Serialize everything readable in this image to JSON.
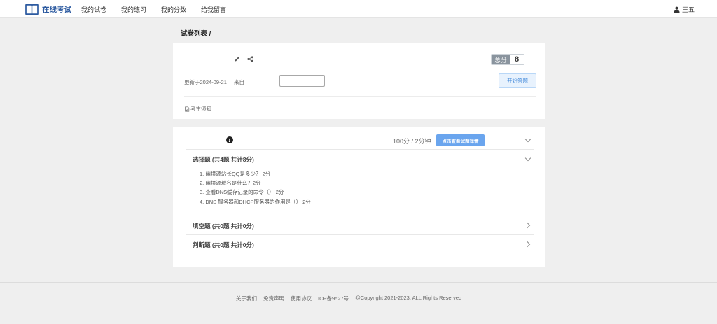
{
  "header": {
    "logo_text": "在线考试",
    "nav": [
      "我的试卷",
      "我的练习",
      "我的分数",
      "给我留言"
    ],
    "user_name": "王五"
  },
  "breadcrumb": "试卷列表 /",
  "exam_info": {
    "total_score_label": "总分",
    "total_score_value": "8",
    "updated": "更新于2024-09-21",
    "from_label": "来自",
    "start_button": "开始答题",
    "notice": "考生须知"
  },
  "summary": {
    "duration": "100分 / 2分钟",
    "detail_button": "点击查看试题详情"
  },
  "sections": [
    {
      "title": "选择题 (共4题 共计8分)",
      "expanded": true,
      "questions": [
        "1. 幽境源站长QQ是多少？ 2分",
        "2. 幽境源域名是什么？2分",
        "3. 查看DNS缓存记录的命令（） 2分",
        "4. DNS 服务器和DHCP服务器的作用是（） 2分"
      ]
    },
    {
      "title": "填空题 (共0题 共计0分)",
      "expanded": false
    },
    {
      "title": "判断题 (共0题 共计0分)",
      "expanded": false
    }
  ],
  "footer": {
    "links": [
      "关于我们",
      "免责声明",
      "使用协议",
      "ICP备9527号",
      "@Copyright 2021-2023. ALL Rights Reserved"
    ]
  },
  "colors": {
    "brand": "#2c5aa0",
    "primary_button": "#6aa5ee",
    "score_label_bg": "#8a949e"
  }
}
